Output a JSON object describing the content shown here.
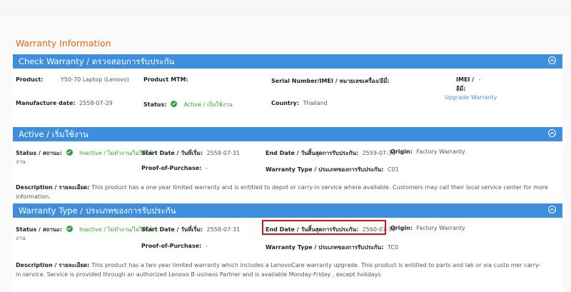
{
  "page_title": "Warranty Information",
  "colors": {
    "header_bg": "#3d8fde",
    "title": "#e8660c",
    "active_green": "#3a9a2c",
    "link": "#4a90d9",
    "highlight": "#d6131b"
  },
  "check_warranty": {
    "title": "Check Warranty / ตรวจสอบการรับประกัน",
    "product_label": "Product:",
    "product_value": "Y50-70 Laptop (Lenovo)",
    "mtm_label": "Product MTM:",
    "serial_label": "Serial Number/IMEI / หมายเลขเครื่อง/อีมี่:",
    "imei_label_1": "IMEI /",
    "imei_label_2": "อีมี่:",
    "imei_value": "-",
    "upgrade_link": "Upgrade Warranty",
    "manufacture_label": "Manufacture date:",
    "manufacture_value": "2558-07-29",
    "status_label": "Status:",
    "status_value": "Active / เริ่มใช้งาน",
    "country_label": "Country:",
    "country_value": "Thailand"
  },
  "active": {
    "title": "Active / เริ่มใช้งาน",
    "status_label": "Status / สถานะ:",
    "status_value_1": "Inactive / ไม่ทำงาน/ไม่ได้ใช้",
    "status_value_2": "งาน",
    "start_label": "Start Date / วันที่เริ่ม:",
    "start_value": "2558-07-31",
    "end_label": "End Date / วันสิ้นสุดการรับประกัน:",
    "end_value": "2559-07-30",
    "origin_label": "Origin:",
    "origin_value": "Factory Warranty",
    "pop_label": "Proof-of-Purchase:",
    "pop_value": "-",
    "type_label": "Warranty Type / ประเภทของการรับประกัน:",
    "type_value": "C01",
    "desc_label": "Description / รายละเอียด:",
    "desc_value": "This product has a one year limited warranty and is entitled to depot or carry-in service where available. Customers may call their local service center for more information."
  },
  "warranty_type": {
    "title": "Warranty Type / ประเภทของการรับประกัน",
    "status_label": "Status / สถานะ:",
    "status_value_1": "Inactive / ไม่ทำงาน/ไม่ได้ใช้",
    "status_value_2": "งาน",
    "start_label": "Start Date / วันที่เริ่ม:",
    "start_value": "2558-07-31",
    "end_label": "End Date / วันสิ้นสุดการรับประกัน:",
    "end_value": "2560-07-30",
    "origin_label": "Origin:",
    "origin_value": "Factory Warranty",
    "pop_label": "Proof-of-Purchase:",
    "pop_value": "-",
    "type_label": "Warranty Type / ประเภทของการรับประกัน:",
    "type_value": "TC0",
    "desc_label": "Description / รายละเอียด:",
    "desc_value": "This product has a two year limited warranty which includes a LenovoCare warranty upgrade. This product is entitled to parts and lab or via custo mer carry-in service. Service is provided through an authorized Lenovo B usiness Partner and is available Monday-Friday , except holidays"
  }
}
